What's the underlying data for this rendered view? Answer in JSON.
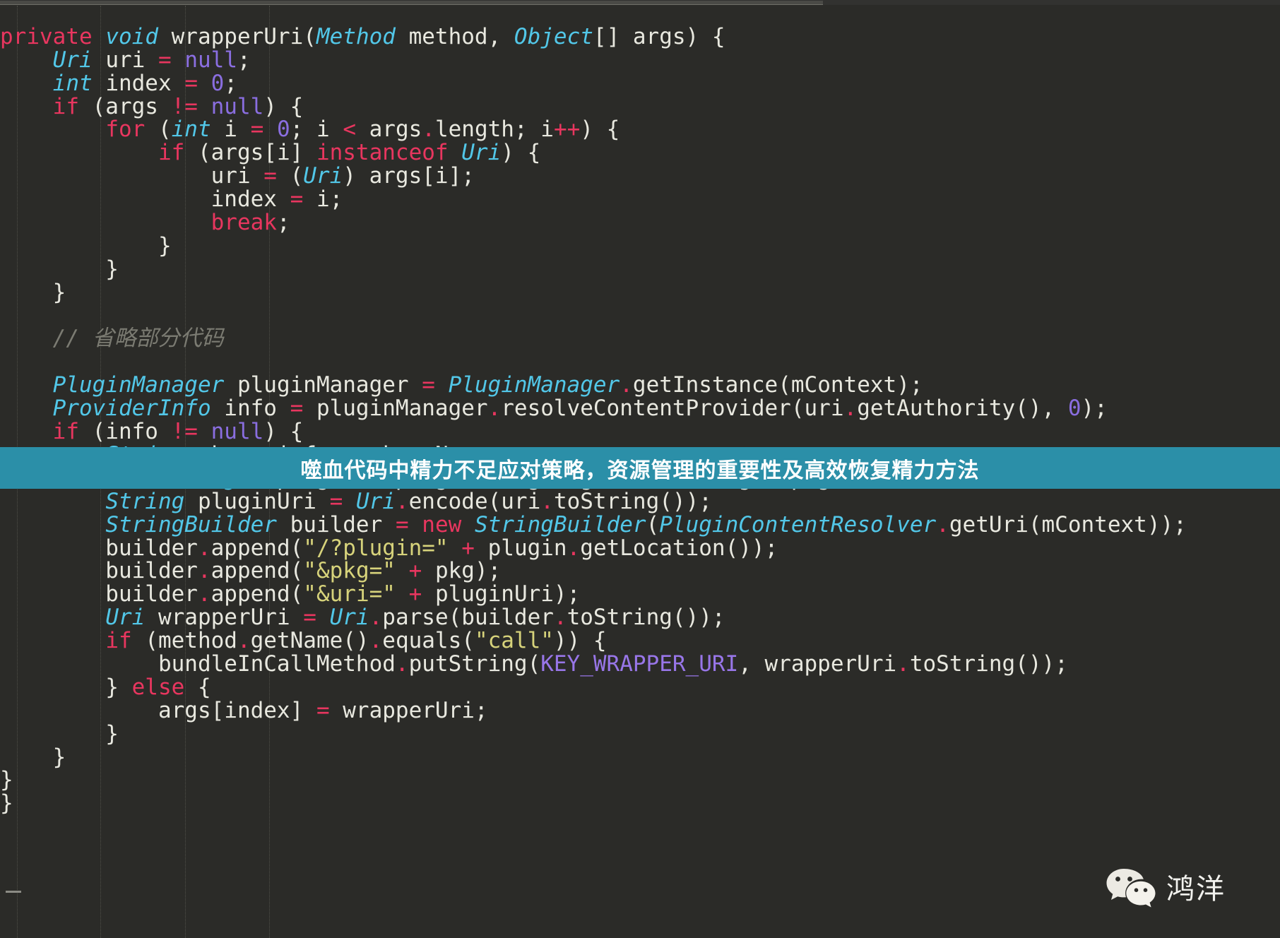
{
  "editor": {
    "theme_background": "#2b2b28",
    "default_text_color": "#e8e8df",
    "language": "java",
    "code_lines": [
      "private void wrapperUri(Method method, Object[] args) {",
      "    Uri uri = null;",
      "    int index = 0;",
      "    if (args != null) {",
      "        for (int i = 0; i < args.length; i++) {",
      "            if (args[i] instanceof Uri) {",
      "                uri = (Uri) args[i];",
      "                index = i;",
      "                break;",
      "            }",
      "        }",
      "    }",
      "",
      "    // 省略部分代码",
      "",
      "    PluginManager pluginManager = PluginManager.getInstance(mContext);",
      "    ProviderInfo info = pluginManager.resolveContentProvider(uri.getAuthority(), 0);",
      "    if (info != null) {",
      "        String pkg = info.packageName;",
      "        LoadedPlugin plugin = pluginManager.getLoadedPlugin(pkg);",
      "        String pluginUri = Uri.encode(uri.toString());",
      "        StringBuilder builder = new StringBuilder(PluginContentResolver.getUri(mContext));",
      "        builder.append(\"/?plugin=\" + plugin.getLocation());",
      "        builder.append(\"&pkg=\" + pkg);",
      "        builder.append(\"&uri=\" + pluginUri);",
      "        Uri wrapperUri = Uri.parse(builder.toString());",
      "        if (method.getName().equals(\"call\")) {",
      "            bundleInCallMethod.putString(KEY_WRAPPER_URI, wrapperUri.toString());",
      "        } else {",
      "            args[index] = wrapperUri;",
      "        }",
      "    }",
      "}",
      "}"
    ],
    "syntax_colors": {
      "keyword": "#e8365f",
      "type": "#52c7e8",
      "number_literal": "#8a6ee0",
      "string_literal": "#d7d37b",
      "comment": "#7b7b72",
      "constant": "#9876e8",
      "identifier": "#e8e8df",
      "punctuation_dot": "#e8365f"
    },
    "comment_text": "// 省略部分代码"
  },
  "banner": {
    "text": "噬血代码中精力不足应对策略，资源管理的重要性及高效恢复精力方法",
    "background_color": "#2b8fa8",
    "text_color": "#ffffff"
  },
  "watermark": {
    "icon": "wechat-icon",
    "label": "鸿洋"
  },
  "scrollbar": {
    "orientation": "horizontal",
    "position": "top"
  }
}
